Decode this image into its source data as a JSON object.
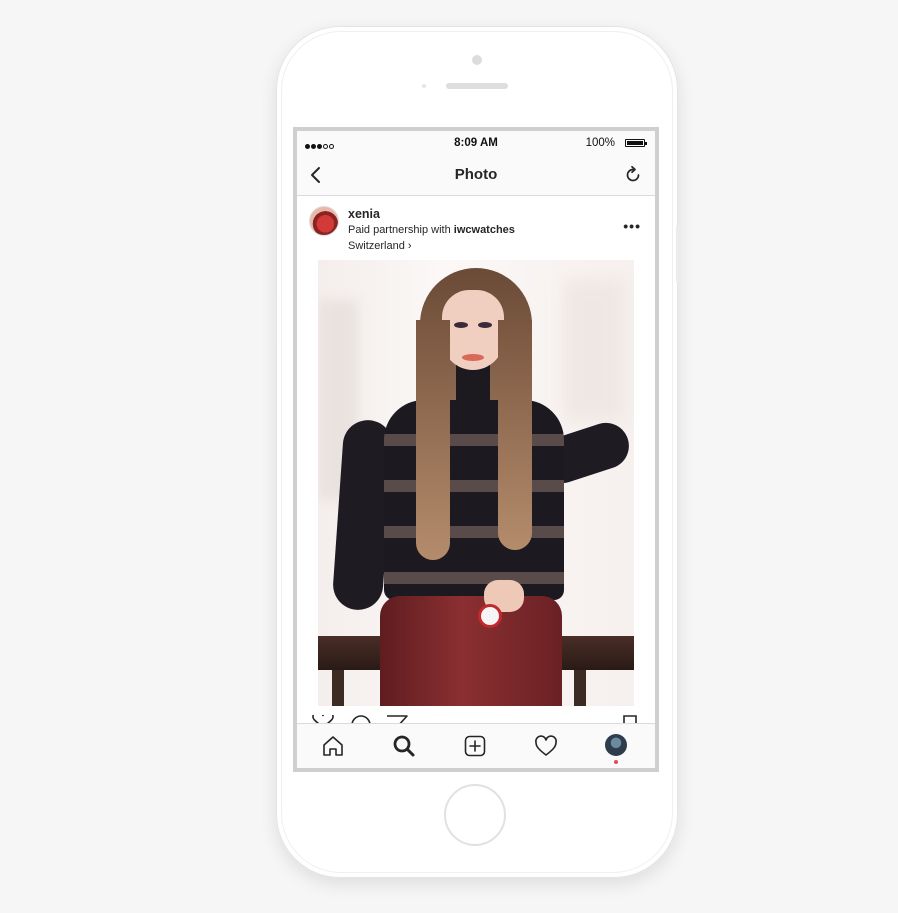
{
  "statusbar": {
    "time": "8:09 AM",
    "battery": "100%"
  },
  "navbar": {
    "title": "Photo",
    "back_icon": "chevron-left-icon",
    "refresh_icon": "refresh-icon"
  },
  "post": {
    "username": "xenia",
    "partnership_prefix": "Paid partnership with ",
    "partner": "iwcwatches",
    "location": "Switzerland ›",
    "more_icon": "more-horizontal-icon"
  },
  "tabbar": {
    "items": [
      "home-icon",
      "search-icon",
      "new-post-icon",
      "activity-heart-icon",
      "profile-avatar"
    ],
    "selected": "search-icon",
    "notification_color": "#ed4956"
  }
}
